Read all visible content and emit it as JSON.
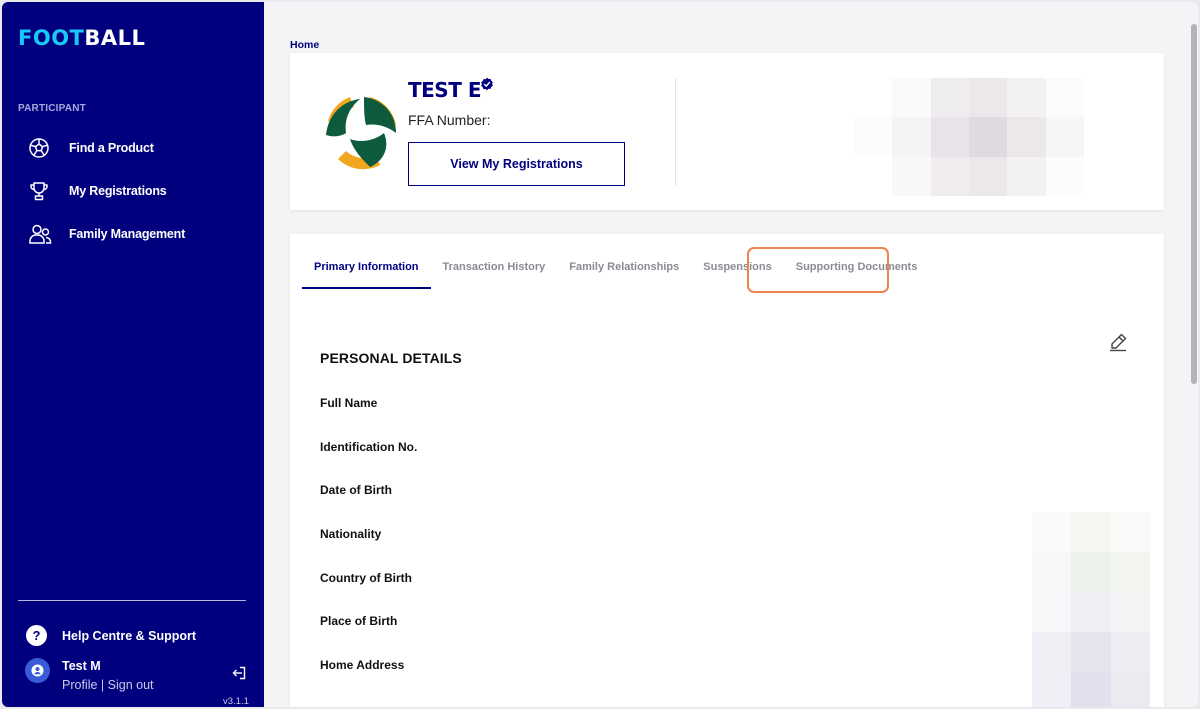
{
  "app": {
    "logo_part1": "FOOT",
    "logo_part2": "BALL"
  },
  "sidebar": {
    "section_label": "PARTICIPANT",
    "items": [
      {
        "label": "Find a Product",
        "icon": "football-icon"
      },
      {
        "label": "My Registrations",
        "icon": "trophy-icon"
      },
      {
        "label": "Family Management",
        "icon": "people-icon"
      }
    ],
    "help_label": "Help Centre & Support",
    "user": {
      "name": "Test M",
      "profile_link": "Profile",
      "separator": " | ",
      "signout_link": "Sign out"
    },
    "version": "v3.1.1"
  },
  "breadcrumb": "Home",
  "profile": {
    "name": "TEST E",
    "ffa_label": "FFA Number:",
    "view_button": "View My Registrations"
  },
  "tabs": [
    {
      "label": "Primary Information",
      "active": true
    },
    {
      "label": "Transaction History",
      "active": false
    },
    {
      "label": "Family Relationships",
      "active": false
    },
    {
      "label": "Suspensions",
      "active": false
    },
    {
      "label": "Supporting Documents",
      "active": false
    }
  ],
  "personal_details": {
    "title": "PERSONAL DETAILS",
    "fields": [
      "Full Name",
      "Identification No.",
      "Date of Birth",
      "Nationality",
      "Country of Birth",
      "Place of Birth",
      "Home Address"
    ]
  },
  "colors": {
    "brand_navy": "#00007f",
    "logo_cyan": "#18c9f5",
    "highlight_orange": "#f0844e",
    "logo_green": "#0e5a3d",
    "logo_gold": "#f2a81e"
  }
}
